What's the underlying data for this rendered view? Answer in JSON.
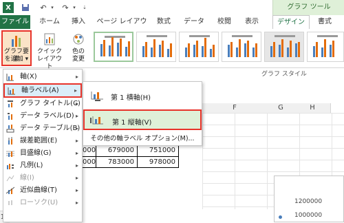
{
  "titlebar": {
    "app_icon": "excel-icon",
    "qat": [
      "save-icon",
      "undo-icon",
      "redo-icon",
      "customize-icon"
    ],
    "tool_group_label": "グラフ ツール"
  },
  "tabs": [
    "ファイル",
    "ホーム",
    "挿入",
    "ページ レイアウト",
    "数式",
    "データ",
    "校閲",
    "表示",
    "デザイン",
    "書式"
  ],
  "ribbon": {
    "add_element_label_1": "グラフ要素",
    "add_element_label_2": "を追加",
    "quick_layout_1": "クイック",
    "quick_layout_2": "レイアウト",
    "change_color_1": "色の",
    "change_color_2": "変更",
    "styles_section": "グラフ スタイル"
  },
  "sheet": {
    "columns": [
      "F",
      "G",
      "H"
    ],
    "rows": [
      {
        "a": "000",
        "b": "679000",
        "c": "751000"
      },
      {
        "a": "000",
        "b": "783000",
        "c": "978000"
      }
    ],
    "row_label": "11",
    "chart_tick_1": "1200000",
    "chart_tick_2": "1000000"
  },
  "menu": {
    "items": [
      {
        "label": "軸(X)",
        "icon": "axis-icon",
        "arrow": "▸",
        "disabled": false
      },
      {
        "label": "軸ラベル(A)",
        "icon": "axis-label-icon",
        "arrow": "▸",
        "disabled": false
      },
      {
        "label": "グラフ タイトル(C)",
        "icon": "chart-title-icon",
        "arrow": "▸",
        "disabled": false
      },
      {
        "label": "データ ラベル(D)",
        "icon": "data-label-icon",
        "arrow": "▸",
        "disabled": false
      },
      {
        "label": "データ テーブル(B)",
        "icon": "data-table-icon",
        "arrow": "▸",
        "disabled": false
      },
      {
        "label": "誤差範囲(E)",
        "icon": "error-bar-icon",
        "arrow": "▸",
        "disabled": false
      },
      {
        "label": "目盛線(G)",
        "icon": "gridline-icon",
        "arrow": "▸",
        "disabled": false
      },
      {
        "label": "凡例(L)",
        "icon": "legend-icon",
        "arrow": "▸",
        "disabled": false
      },
      {
        "label": "線(I)",
        "icon": "line-icon",
        "arrow": "▸",
        "disabled": true
      },
      {
        "label": "近似曲線(T)",
        "icon": "trendline-icon",
        "arrow": "▸",
        "disabled": false
      },
      {
        "label": "ローソク(U)",
        "icon": "candlestick-icon",
        "arrow": "▸",
        "disabled": true
      }
    ]
  },
  "submenu": {
    "horizontal": "第 1 横軸(H)",
    "vertical": "第 1 縦軸(V)",
    "more": "その他の軸ラベル オプション(M)..."
  },
  "colors": {
    "excel_green": "#217346",
    "highlight_red": "#e8332a",
    "hover_blue": "#dbeef9"
  }
}
